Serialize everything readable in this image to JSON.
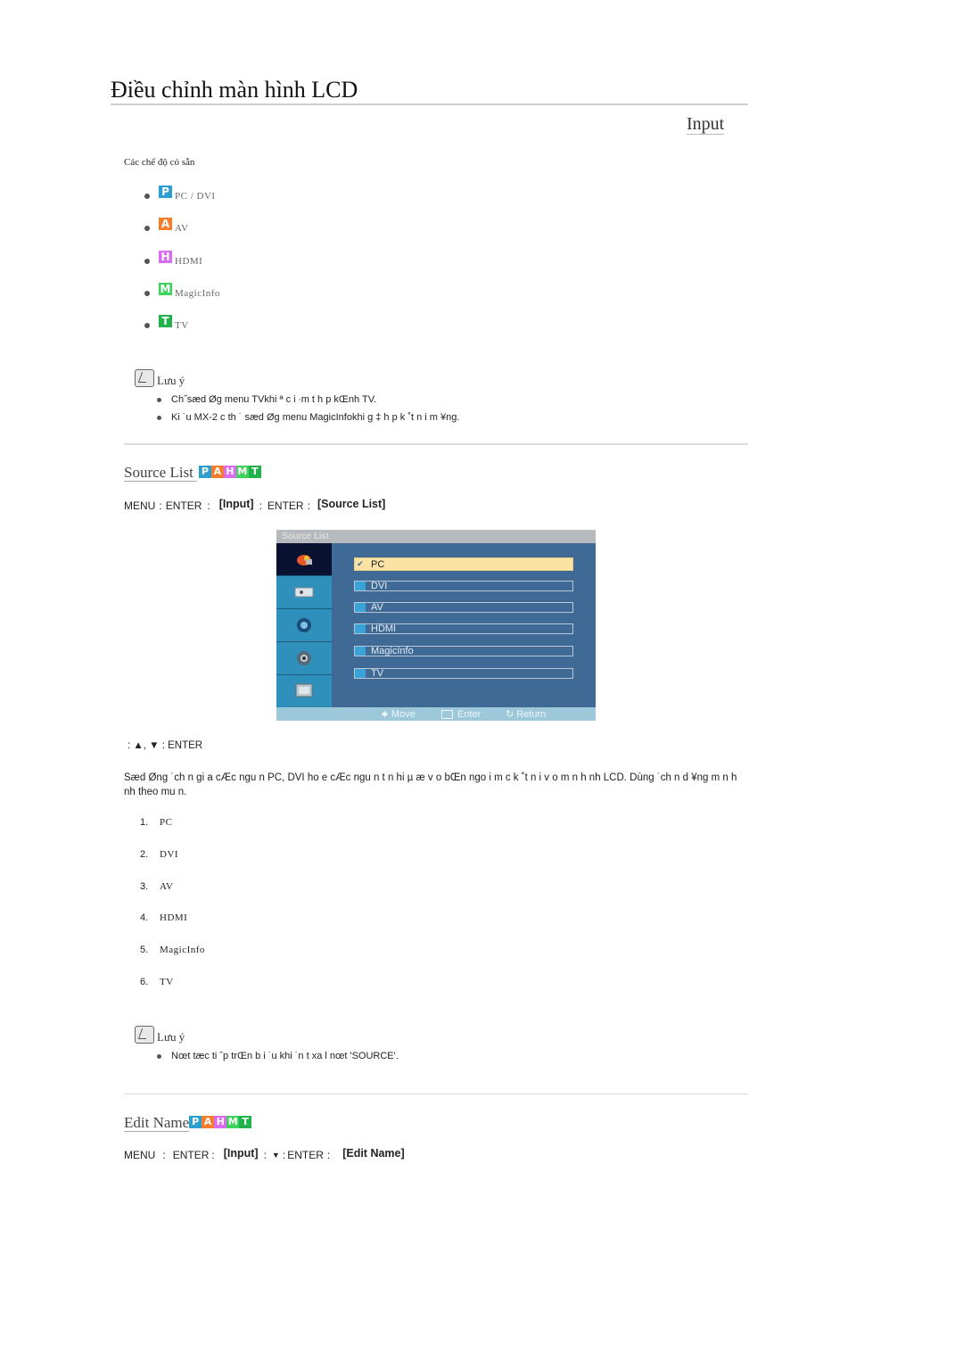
{
  "page": {
    "title": "Điều chỉnh màn hình LCD",
    "section": "Input"
  },
  "modes": {
    "label": "Các chế độ có sẵn",
    "items": [
      {
        "badge": "P",
        "label": "PC / DVI",
        "color": "#2a9fd0"
      },
      {
        "badge": "A",
        "label": "AV",
        "color": "#f57c2a"
      },
      {
        "badge": "H",
        "label": "HDMI",
        "color": "#d96cf0"
      },
      {
        "badge": "M",
        "label": "MagicInfo",
        "color": "#3ed35a"
      },
      {
        "badge": "T",
        "label": "TV",
        "color": "#22b24c"
      }
    ]
  },
  "note1": {
    "label": "Lưu ý",
    "items": [
      "Ch˝sæd Øg menu TVkhi  ª c i   ∙m  t h  p kŒnh TV.",
      "Ki ˙u MX-2 c  th ˙ sæd Øg menu MagicInfokhi    g ‡ h p k ˚t n  i m ¥ng."
    ]
  },
  "source_list": {
    "title": "Source List",
    "badges": [
      "P",
      "A",
      "H",
      "M",
      "T"
    ],
    "badge_colors": [
      "#2a9fd0",
      "#f57c2a",
      "#d96cf0",
      "#3ed35a",
      "#22b24c"
    ],
    "path": {
      "menu": "MENU",
      "sep": ":",
      "enter": "ENTER",
      "input": "[Input]",
      "target": "[Source List]"
    },
    "osd": {
      "title": "Source List",
      "side_tabs": [
        "input-icon",
        "picture-icon",
        "sound-icon",
        "setup-icon",
        "multi-control-icon"
      ],
      "rows": [
        {
          "label": "PC",
          "selected": true
        },
        {
          "label": "DVI",
          "selected": false
        },
        {
          "label": "AV",
          "selected": false
        },
        {
          "label": "HDMI",
          "selected": false
        },
        {
          "label": "MagicInfo",
          "selected": false
        },
        {
          "label": "TV",
          "selected": false
        }
      ],
      "footer": {
        "move": "Move",
        "enter": "Enter",
        "return": "Return"
      }
    },
    "nav_line": ":  ▲, ▼ : ENTER",
    "description": "Sæd Øng ˙ch n gi a cÆc ngu n PC, DVI ho e cÆc ngu n t n hi µ   æ v o bŒn ngo i m c k ˚t n  i v o m n h nh LCD. Dùng ˙ch n d ¥ng m n h nh theo   mu n.",
    "numbered": [
      "PC",
      "DVI",
      "AV",
      "HDMI",
      "MagicInfo",
      "TV"
    ]
  },
  "note2": {
    "label": "Lưu ý",
    "items": [
      "Nœt tæc ti ˆp trŒn b  i ˙u khi ˙n t   xa l  nœt 'SOURCE'."
    ]
  },
  "edit_name": {
    "title": "Edit Name",
    "badges": [
      "P",
      "A",
      "H",
      "M",
      "T"
    ],
    "badge_colors": [
      "#2a9fd0",
      "#f57c2a",
      "#d96cf0",
      "#3ed35a",
      "#22b24c"
    ],
    "path": {
      "menu": "MENU",
      "sep": ":",
      "enter": "ENTER",
      "input": "[Input]",
      "down": "▼",
      "target": "[Edit Name]"
    }
  }
}
